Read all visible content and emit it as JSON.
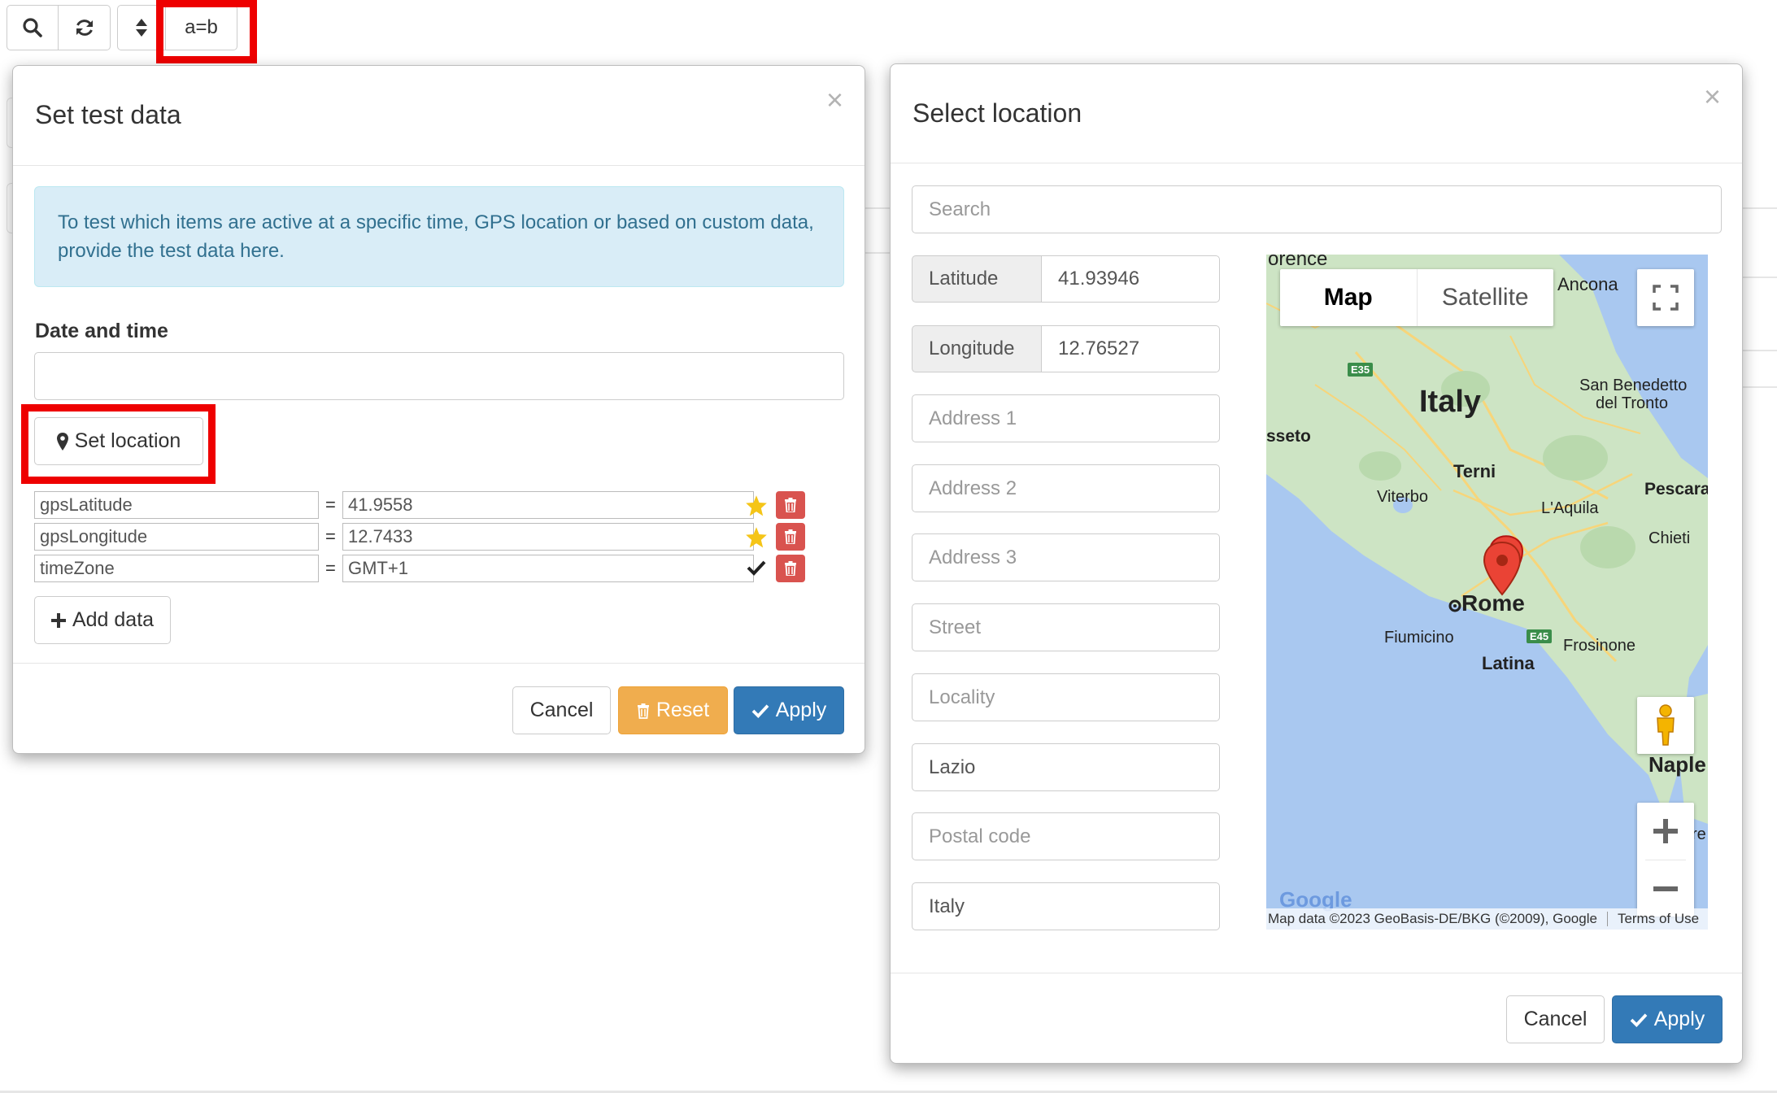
{
  "toolbar": {
    "icons": [
      "search-icon",
      "refresh-icon",
      "sort-icon"
    ],
    "ab_label": "a=b"
  },
  "test_modal": {
    "title": "Set test data",
    "close": "×",
    "info": "To test which items are active at a specific time, GPS location or based on custom data, provide the test data here.",
    "date_label": "Date and time",
    "date_value": "",
    "set_location_label": "Set location",
    "rows": [
      {
        "key": "gpsLatitude",
        "value": "41.9558",
        "status_icon": "star-icon"
      },
      {
        "key": "gpsLongitude",
        "value": "12.7433",
        "status_icon": "star-icon"
      },
      {
        "key": "timeZone",
        "value": "GMT+1",
        "status_icon": "check-icon"
      }
    ],
    "equals": "=",
    "add_data_label": "Add data",
    "cancel_label": "Cancel",
    "reset_label": "Reset",
    "apply_label": "Apply"
  },
  "location_modal": {
    "title": "Select location",
    "close": "×",
    "search_placeholder": "Search",
    "latitude_label": "Latitude",
    "latitude_value": "41.93946",
    "longitude_label": "Longitude",
    "longitude_value": "12.76527",
    "address1_placeholder": "Address 1",
    "address2_placeholder": "Address 2",
    "address3_placeholder": "Address 3",
    "street_placeholder": "Street",
    "locality_placeholder": "Locality",
    "region_value": "Lazio",
    "postal_placeholder": "Postal code",
    "country_value": "Italy",
    "cancel_label": "Cancel",
    "apply_label": "Apply"
  },
  "map": {
    "tab_map": "Map",
    "tab_satellite": "Satellite",
    "labels": {
      "firenze": "orence",
      "ancona": "Ancona",
      "italy": "Italy",
      "san_benedetto": "San Benedetto",
      "del_tronto": "del Tronto",
      "grosseto": "sseto",
      "terni": "Terni",
      "viterbo": "Viterbo",
      "pescara": "Pescara",
      "laquila": "L'Aquila",
      "chieti": "Chieti",
      "rome": "Rome",
      "fiumicino": "Fiumicino",
      "frosinone": "Frosinone",
      "latina": "Latina",
      "naples": "Naple",
      "caserta": "re",
      "e35": "E35",
      "e45": "E45"
    },
    "attribution": "Map data ©2023 GeoBasis-DE/BKG (©2009), Google",
    "terms": "Terms of Use",
    "google_logo": "Google",
    "colors": {
      "water": "#a9c8f0",
      "land": "#cde4c4",
      "road": "#f7d57a",
      "marker": "#ea4335"
    }
  }
}
